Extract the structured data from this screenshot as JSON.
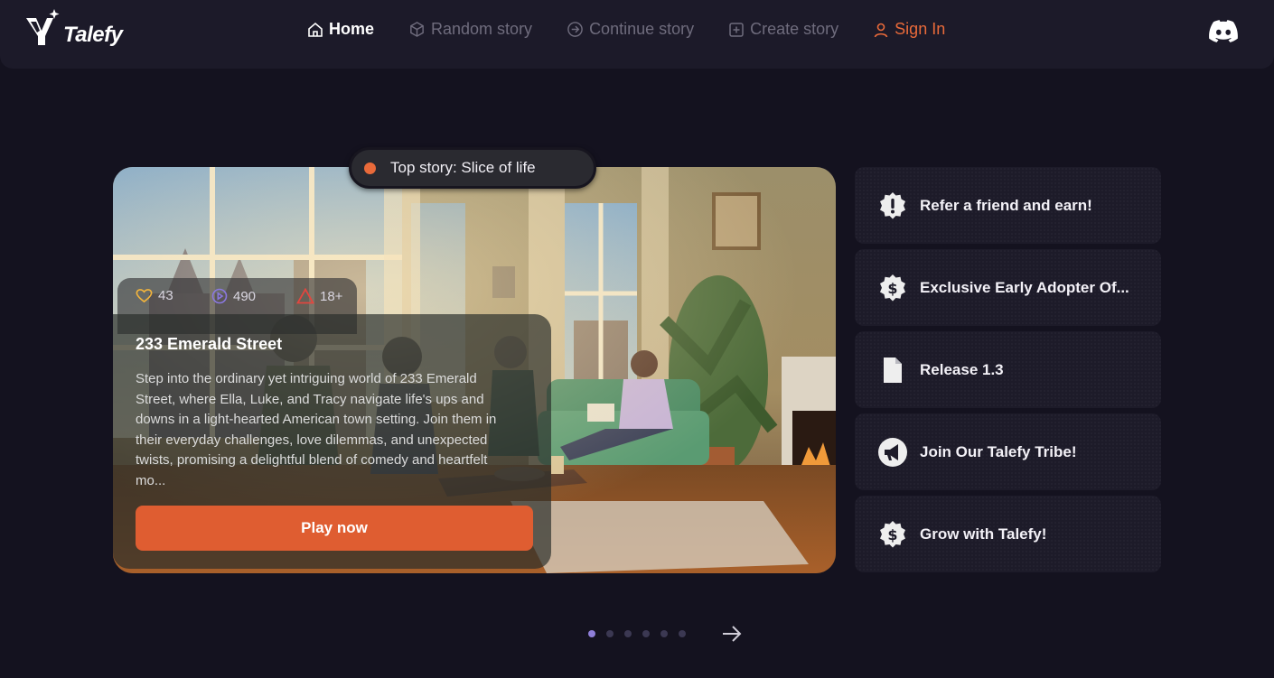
{
  "nav": {
    "logo_text": "Talefy",
    "items": [
      {
        "label": "Home",
        "icon": "home-icon"
      },
      {
        "label": "Random story",
        "icon": "cube-icon"
      },
      {
        "label": "Continue story",
        "icon": "arrow-circle-icon"
      },
      {
        "label": "Create story",
        "icon": "plus-square-icon"
      },
      {
        "label": "Sign In",
        "icon": "user-icon"
      }
    ],
    "discord_icon": "discord-icon"
  },
  "hero": {
    "badge": "Top story: Slice of life",
    "stats": {
      "likes": "43",
      "plays": "490",
      "rating": "18+"
    },
    "title": "233 Emerald Street",
    "description": "Step into the ordinary yet intriguing world of 233 Emerald Street, where Ella, Luke, and Tracy navigate life's ups and downs in a light-hearted American town setting. Join them in their everyday challenges, love dilemmas, and unexpected twists, promising a delightful blend of comedy and heartfelt mo...",
    "play_label": "Play now"
  },
  "side_items": [
    {
      "label": "Refer a friend and earn!",
      "icon": "badge-alert-icon"
    },
    {
      "label": "Exclusive Early Adopter Of...",
      "icon": "badge-dollar-icon"
    },
    {
      "label": "Release 1.3",
      "icon": "document-icon"
    },
    {
      "label": "Join Our Talefy Tribe!",
      "icon": "megaphone-icon"
    },
    {
      "label": "Grow with Talefy!",
      "icon": "badge-dollar-icon"
    }
  ],
  "pagination": {
    "total": 6,
    "active": 1
  },
  "colors": {
    "accent": "#df5d31",
    "signin": "#e96a3a",
    "background": "#14121f",
    "nav": "#1c1a29",
    "active_dot": "#8f7fd9"
  }
}
